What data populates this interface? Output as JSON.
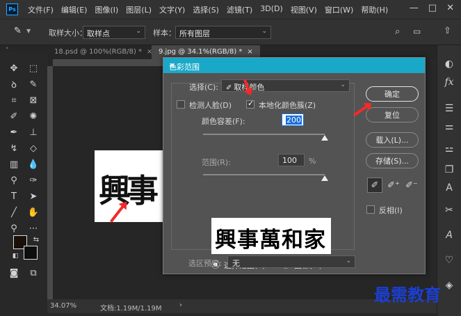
{
  "menubar": {
    "logo": "Ps",
    "items": [
      "文件(F)",
      "编辑(E)",
      "图像(I)",
      "图层(L)",
      "文字(Y)",
      "选择(S)",
      "滤镜(T)",
      "3D(D)",
      "视图(V)",
      "窗口(W)",
      "帮助(H)"
    ],
    "controls": [
      "—",
      "□",
      "✕"
    ]
  },
  "options": {
    "sample_size_label": "取样大小：",
    "sample_size_value": "取样点",
    "sample_label": "样本：",
    "sample_value": "所有图层"
  },
  "tabs": [
    {
      "label": "18.psd @ 100%(RGB/8) *",
      "active": false
    },
    {
      "label": "9.jpg @ 34.1%(RGB/8) *",
      "active": true
    }
  ],
  "status": {
    "zoom": "34.07%",
    "doc": "文档:1.19M/1.19M"
  },
  "dialog": {
    "title": "色彩范围",
    "select_label": "选择(C):",
    "select_value": "取样颜色",
    "detect_faces": "检测人脸(D)",
    "localized": "本地化颜色簇(Z)",
    "fuzziness_label": "颜色容差(F):",
    "fuzziness_value": "200",
    "fuzziness_level": 1.0,
    "range_label": "范围(R):",
    "range_value": "100",
    "range_unit": "%",
    "range_level": 1.0,
    "preview_text": "興事萬和家",
    "radio_selection": "选择范围(E)",
    "radio_image": "图像(M)",
    "selection_preview_label": "选区预览:",
    "selection_preview_value": "无",
    "buttons": {
      "ok": "确定",
      "reset": "复位",
      "load": "载入(L)...",
      "save": "存储(S)..."
    },
    "invert": "反相(I)"
  },
  "canvas_art": {
    "text": "興事"
  },
  "watermark": "最需教育",
  "colors": {
    "accent": "#1aa8c8",
    "arrow": "#f12a2a",
    "watermark": "#1c3fd0"
  }
}
